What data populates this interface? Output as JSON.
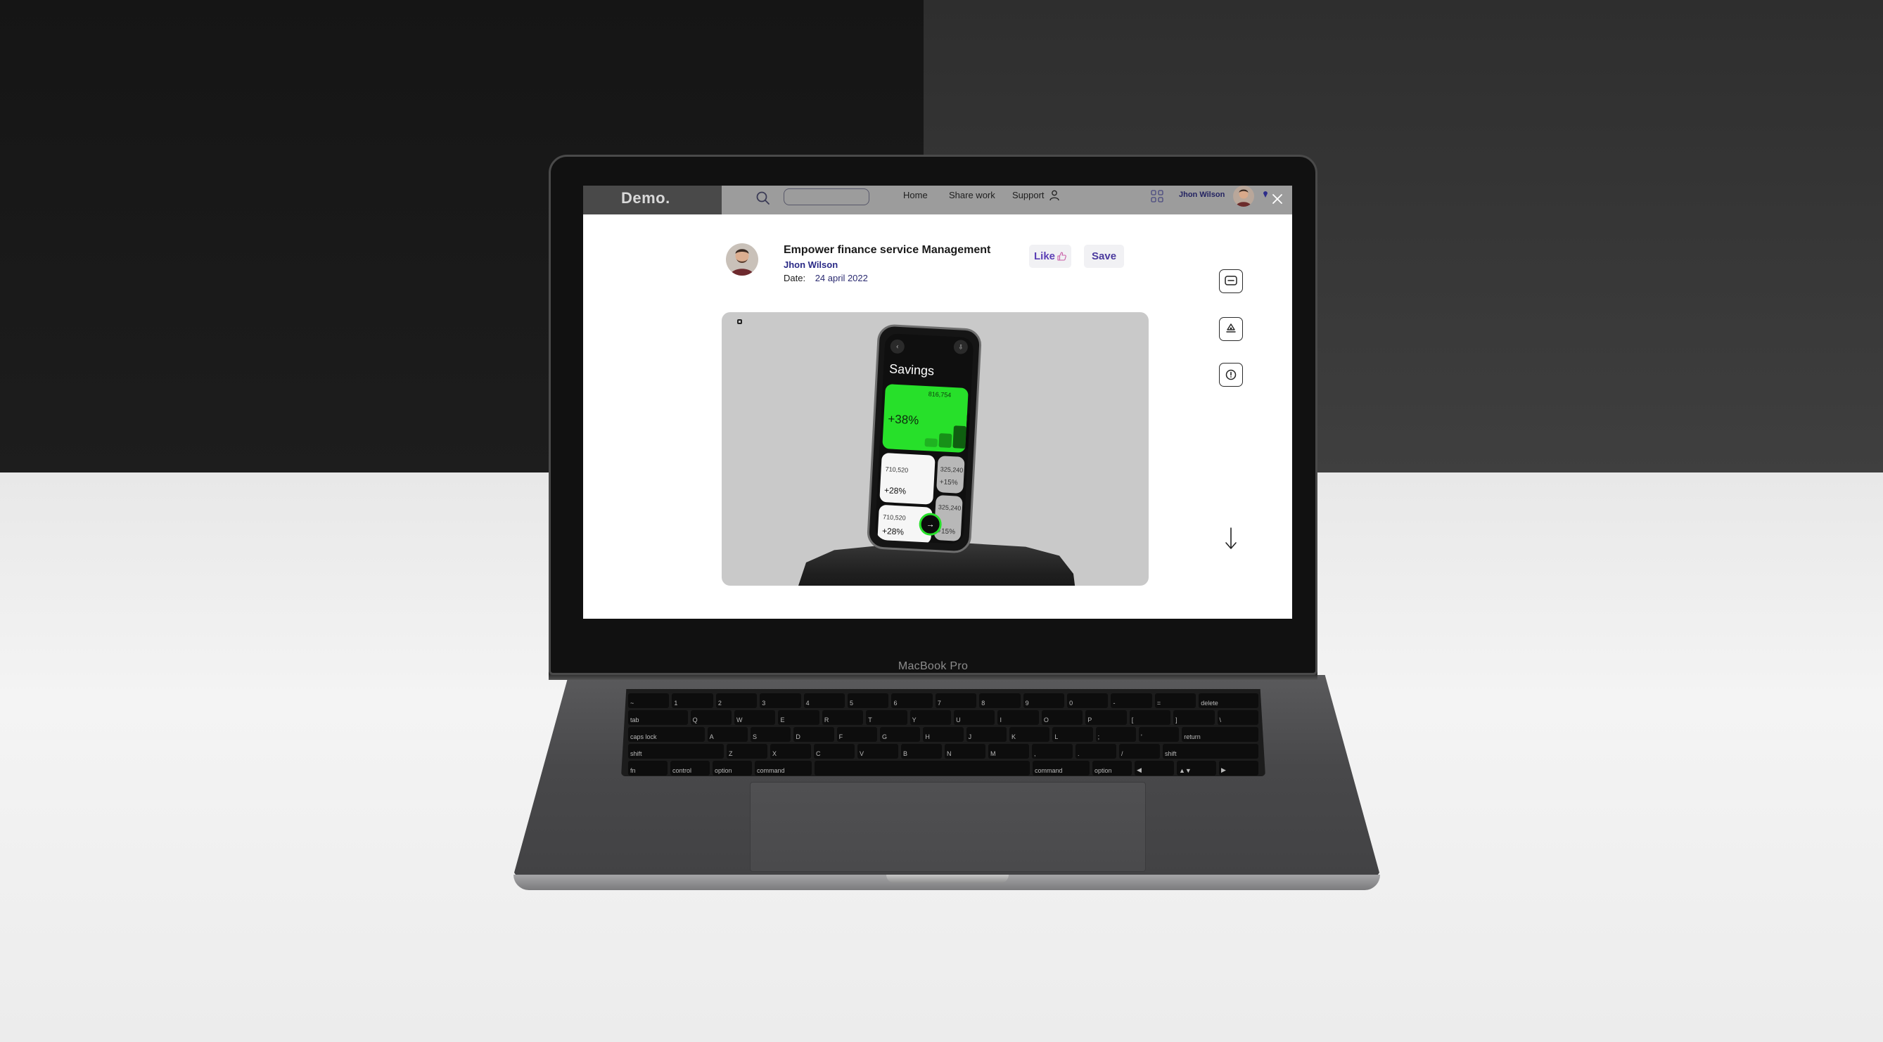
{
  "app": {
    "brand": "Demo.",
    "nav_links": [
      "Home",
      "Share work",
      "Support"
    ],
    "user_name": "Jhon Wilson"
  },
  "post": {
    "title": "Empower finance service Management",
    "author": "Jhon Wilson",
    "date_label": "Date:",
    "date_value": "24 april 2022",
    "like_label": "Like",
    "save_label": "Save"
  },
  "side_tools": [
    "message-icon",
    "recycle-icon",
    "info-icon",
    "arrow-down-icon"
  ],
  "mockup": {
    "screen_title": "Savings",
    "balance": "816,754",
    "main_change": "+38%",
    "card1_amount": "710,520",
    "card1_change": "+28%",
    "card2_amount": "710,520",
    "card2_change": "+28%",
    "grey1_amount": "325,240",
    "grey1_change": "+15%",
    "grey2_amount": "325,240",
    "grey2_change": "+15%",
    "accent_color": "#27e02a"
  },
  "device": {
    "label": "MacBook Pro"
  },
  "keyboard": {
    "row1": [
      "~",
      "1",
      "2",
      "3",
      "4",
      "5",
      "6",
      "7",
      "8",
      "9",
      "0",
      "-",
      "=",
      "delete"
    ],
    "row2": [
      "tab",
      "Q",
      "W",
      "E",
      "R",
      "T",
      "Y",
      "U",
      "I",
      "O",
      "P",
      "[",
      "]",
      "\\"
    ],
    "row3": [
      "caps lock",
      "A",
      "S",
      "D",
      "F",
      "G",
      "H",
      "J",
      "K",
      "L",
      ";",
      "'",
      "return"
    ],
    "row4": [
      "shift",
      "Z",
      "X",
      "C",
      "V",
      "B",
      "N",
      "M",
      ",",
      ".",
      "/",
      "shift"
    ],
    "row5": [
      "fn",
      "control",
      "option",
      "command",
      "",
      "command",
      "option",
      "◀",
      "▲▼",
      "▶"
    ]
  },
  "colors": {
    "accent_purple": "#5b3fb5",
    "navy_text": "#2a2a86",
    "modal_bg": "#ffffff"
  }
}
